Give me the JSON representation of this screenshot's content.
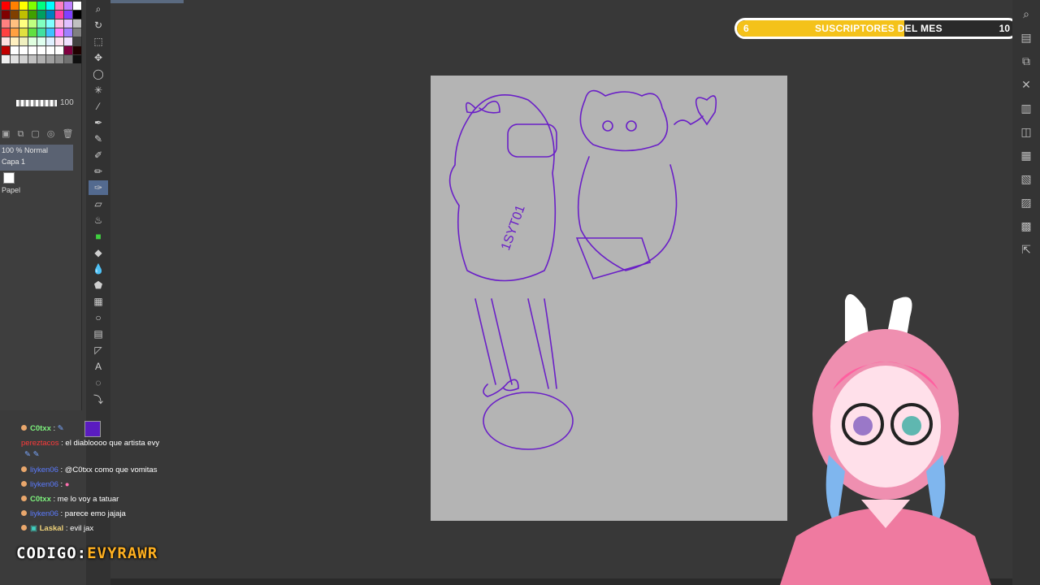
{
  "palette": [
    "#ff0000",
    "#ff8000",
    "#ffff00",
    "#80ff00",
    "#00ff80",
    "#00ffff",
    "#ff80c0",
    "#c080ff",
    "#ffffff",
    "#800000",
    "#804000",
    "#c0c000",
    "#40a000",
    "#00a060",
    "#0080c0",
    "#ff40a0",
    "#8040ff",
    "#000000",
    "#ff8080",
    "#ffc080",
    "#ffff80",
    "#c0ff80",
    "#80ffc0",
    "#80ffff",
    "#ffc0e0",
    "#e0c0ff",
    "#c0c0c0",
    "#ff4040",
    "#ffa040",
    "#e0e040",
    "#60e040",
    "#40e0a0",
    "#40c0ff",
    "#ff80ff",
    "#a080ff",
    "#808080",
    "#ffe0e0",
    "#fff0c0",
    "#f0f0c0",
    "#e0ffe0",
    "#e0fff0",
    "#e0f0ff",
    "#ffe0f0",
    "#f0e0ff",
    "#404040",
    "#c00000",
    "#ffffff",
    "#ffffff",
    "#ffffff",
    "#ffffff",
    "#ffffff",
    "#ffffff",
    "#800040",
    "#200000",
    "#f0f0f0",
    "#e0e0e0",
    "#d0d0d0",
    "#c0c0c0",
    "#b0b0b0",
    "#a0a0a0",
    "#909090",
    "#707070",
    "#101010"
  ],
  "brush": {
    "value": "100"
  },
  "layers": {
    "mode": "100 % Normal",
    "layer1": "Capa 1",
    "paper": "Papel"
  },
  "subscribers": {
    "start": "6",
    "title": "SUSCRIPTORES DEL MES",
    "end": "10",
    "progress": 0.6,
    "fill_color": "#f4c21a"
  },
  "chat": {
    "messages": [
      {
        "user": "C0txx",
        "sep": " : ",
        "text": "",
        "user_color": "#7df27d"
      },
      {
        "user": "pereztacos",
        "sep": " : ",
        "text": "el diabloooo que artista evy",
        "user_color": "#ff3b3b"
      },
      {
        "user": "liyken06",
        "sep": " : ",
        "text": "@C0txx como que vomitas",
        "user_color": "#5b7bff"
      },
      {
        "user": "liyken06",
        "sep": " : ",
        "text": "",
        "user_color": "#5b7bff"
      },
      {
        "user": "C0txx",
        "sep": " : ",
        "text": "me lo voy a tatuar",
        "user_color": "#7df27d"
      },
      {
        "user": "liyken06",
        "sep": " : ",
        "text": "parece emo jajaja",
        "user_color": "#5b7bff"
      },
      {
        "user": "Laskal",
        "sep": " : ",
        "text": "evil jax",
        "user_color": "#f0d37a"
      }
    ]
  },
  "codigo": {
    "label": "CODIGO:",
    "value": "EVYRAWR"
  },
  "icons": {
    "tools": [
      "zoom-icon",
      "rotate-icon",
      "move-layer-icon",
      "move-icon",
      "lasso-icon",
      "magic-wand-icon",
      "eyedropper-icon",
      "pen-icon",
      "pencil-icon",
      "brush-icon",
      "airbrush-icon",
      "decoration-icon",
      "eraser-icon",
      "blend-icon",
      "fill-icon",
      "gradient-icon",
      "figure-icon",
      "frame-icon",
      "ruler-icon",
      "text-icon",
      "balloon-icon",
      "correct-line-icon"
    ],
    "right": [
      "search-icon",
      "layer-icon",
      "copy-icon",
      "close-icon",
      "layer-settings-icon",
      "layer-mask-icon",
      "merge-icon",
      "folder-icon",
      "property-icon",
      "history-icon",
      "export-icon",
      "delete-icon"
    ]
  }
}
